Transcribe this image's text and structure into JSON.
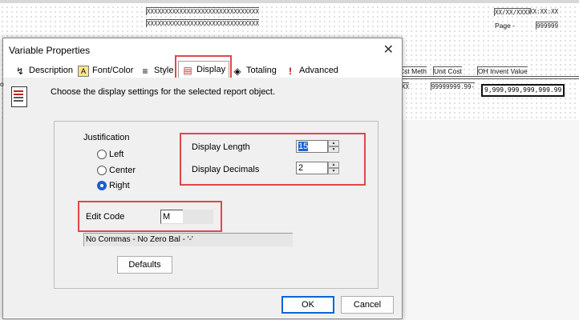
{
  "report": {
    "header_mask_1": "XXXXXXXXXXXXXXXXXXXXXXXXXXXXXXX",
    "header_mask_2": "XXXXXXXXXXXXXXXXXXXXXXXXXXXXXXX",
    "date_mask": "XX/XX/XXXX",
    "time_mask": "XX:XX:XX",
    "page_label": "Page -",
    "page_mask": "999999",
    "columns": [
      "Cst Meth",
      "Unit Cost",
      "OH Invent Value"
    ],
    "row_cst_meth": "XX",
    "row_unit_cost": "99999999.99-",
    "row_oh_value": "9,999,999,999,999.99",
    "left_stub": "o"
  },
  "dialog": {
    "title": "Variable Properties",
    "close_glyph": "✕",
    "tabs": [
      {
        "label": "Description",
        "icon": "↯"
      },
      {
        "label": "Font/Color",
        "icon": "A"
      },
      {
        "label": "Style",
        "icon": "≡"
      },
      {
        "label": "Display",
        "icon": "▤"
      },
      {
        "label": "Totaling",
        "icon": "◈"
      },
      {
        "label": "Advanced",
        "icon": "!"
      }
    ],
    "instruction": "Choose the display settings for the selected report object.",
    "justification": {
      "label": "Justification",
      "options": [
        "Left",
        "Center",
        "Right"
      ],
      "selected": "Right"
    },
    "display_length": {
      "label": "Display Length",
      "value": "15"
    },
    "display_decimals": {
      "label": "Display Decimals",
      "value": "2"
    },
    "edit_code": {
      "label": "Edit Code",
      "value": "M"
    },
    "edit_code_description": "No Commas -  No Zero Bal - '-'",
    "defaults_button": "Defaults",
    "ok_button": "OK",
    "cancel_button": "Cancel",
    "accent_color": "#e0464b"
  }
}
